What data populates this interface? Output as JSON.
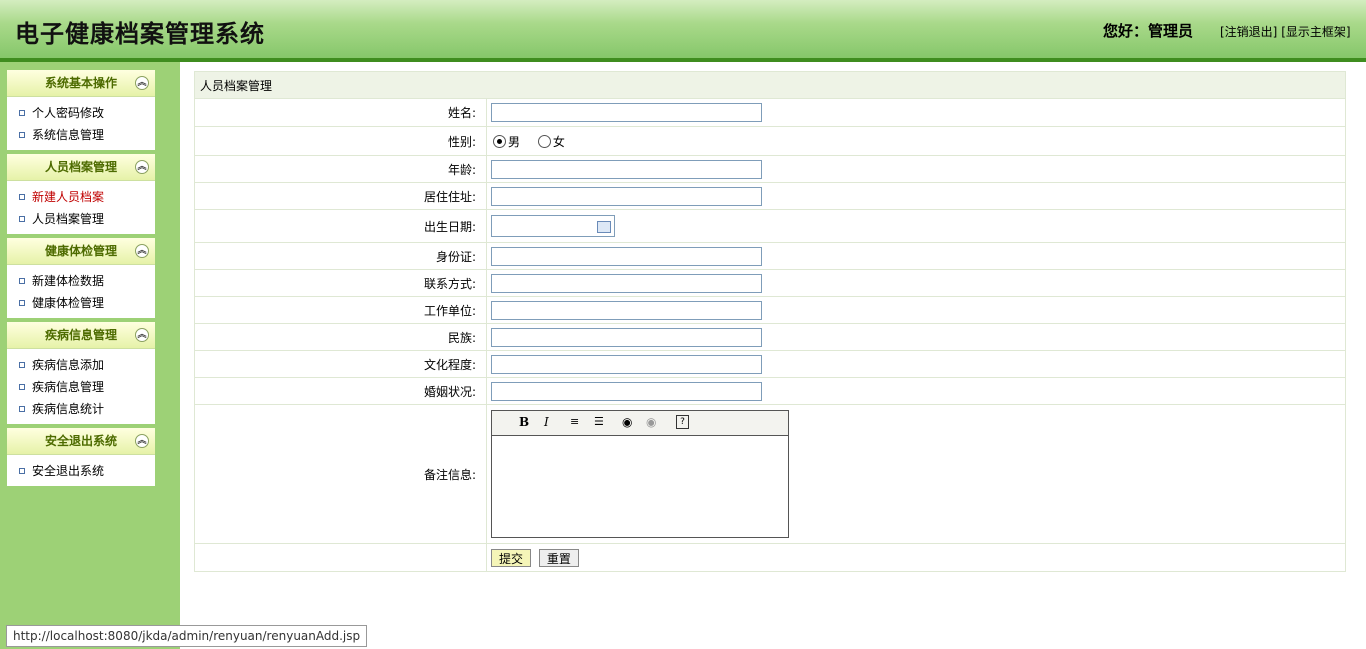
{
  "header": {
    "title": "电子健康档案管理系统",
    "greeting": "您好：管理员",
    "logout_link": "[注销退出]",
    "main_frame_link": "[显示主框架]"
  },
  "sidebar": {
    "groups": [
      {
        "title": "系统基本操作",
        "items": [
          "个人密码修改",
          "系统信息管理"
        ]
      },
      {
        "title": "人员档案管理",
        "items": [
          "新建人员档案",
          "人员档案管理"
        ]
      },
      {
        "title": "健康体检管理",
        "items": [
          "新建体检数据",
          "健康体检管理"
        ]
      },
      {
        "title": "疾病信息管理",
        "items": [
          "疾病信息添加",
          "疾病信息管理",
          "疾病信息统计"
        ]
      },
      {
        "title": "安全退出系统",
        "items": [
          "安全退出系统"
        ]
      }
    ]
  },
  "form": {
    "caption": "人员档案管理",
    "name_label": "姓名:",
    "gender_label": "性别:",
    "gender_male": "男",
    "gender_female": "女",
    "age_label": "年龄:",
    "address_label": "居住住址:",
    "birth_label": "出生日期:",
    "idcard_label": "身份证:",
    "contact_label": "联系方式:",
    "work_label": "工作单位:",
    "ethnic_label": "民族:",
    "education_label": "文化程度:",
    "marital_label": "婚姻状况:",
    "remark_label": "备注信息:",
    "submit": "提交",
    "reset": "重置"
  },
  "editor": {
    "bold": "B",
    "italic": "I",
    "help": "?"
  },
  "status_url": "http://localhost:8080/jkda/admin/renyuan/renyuanAdd.jsp"
}
